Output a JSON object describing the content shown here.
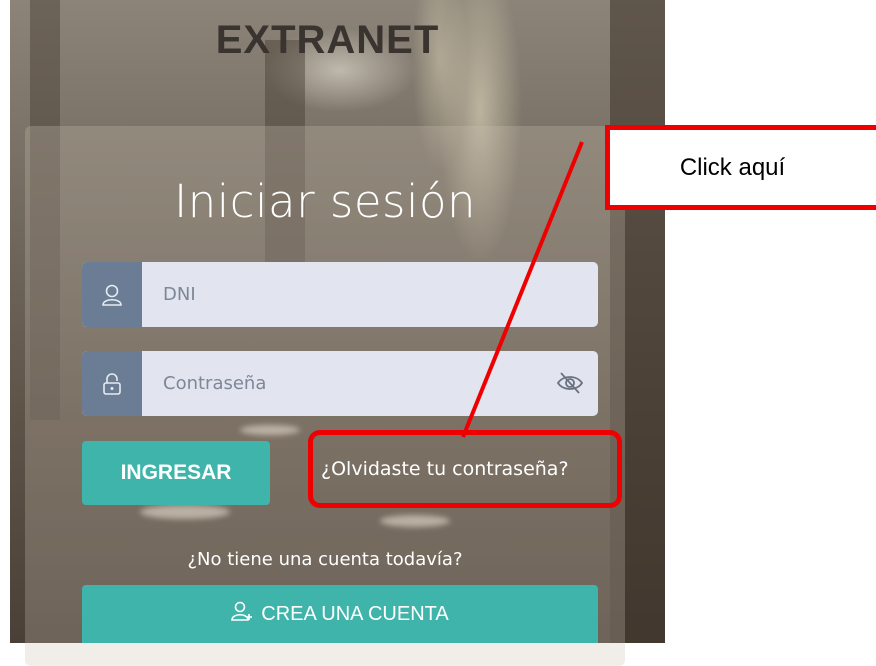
{
  "header": {
    "brand": "EXTRANET"
  },
  "login": {
    "title": "Iniciar sesión",
    "dni": {
      "placeholder": "DNI",
      "icon": "user-icon"
    },
    "password": {
      "placeholder": "Contraseña",
      "icon": "lock-icon",
      "toggle_icon": "eye-slash-icon"
    },
    "submit_label": "INGRESAR",
    "forgot_label": "¿Olvidaste tu contraseña?",
    "no_account_text": "¿No tiene una cuenta todavía?",
    "create_account_label": "CREA UNA CUENTA",
    "create_account_icon": "add-user-icon"
  },
  "annotation": {
    "callout_text": "Click aquí",
    "color": "#ee0000"
  },
  "colors": {
    "accent": "#3fb4ab",
    "input_addon": "#6b7d94",
    "input_bg": "#e2e5ef"
  }
}
